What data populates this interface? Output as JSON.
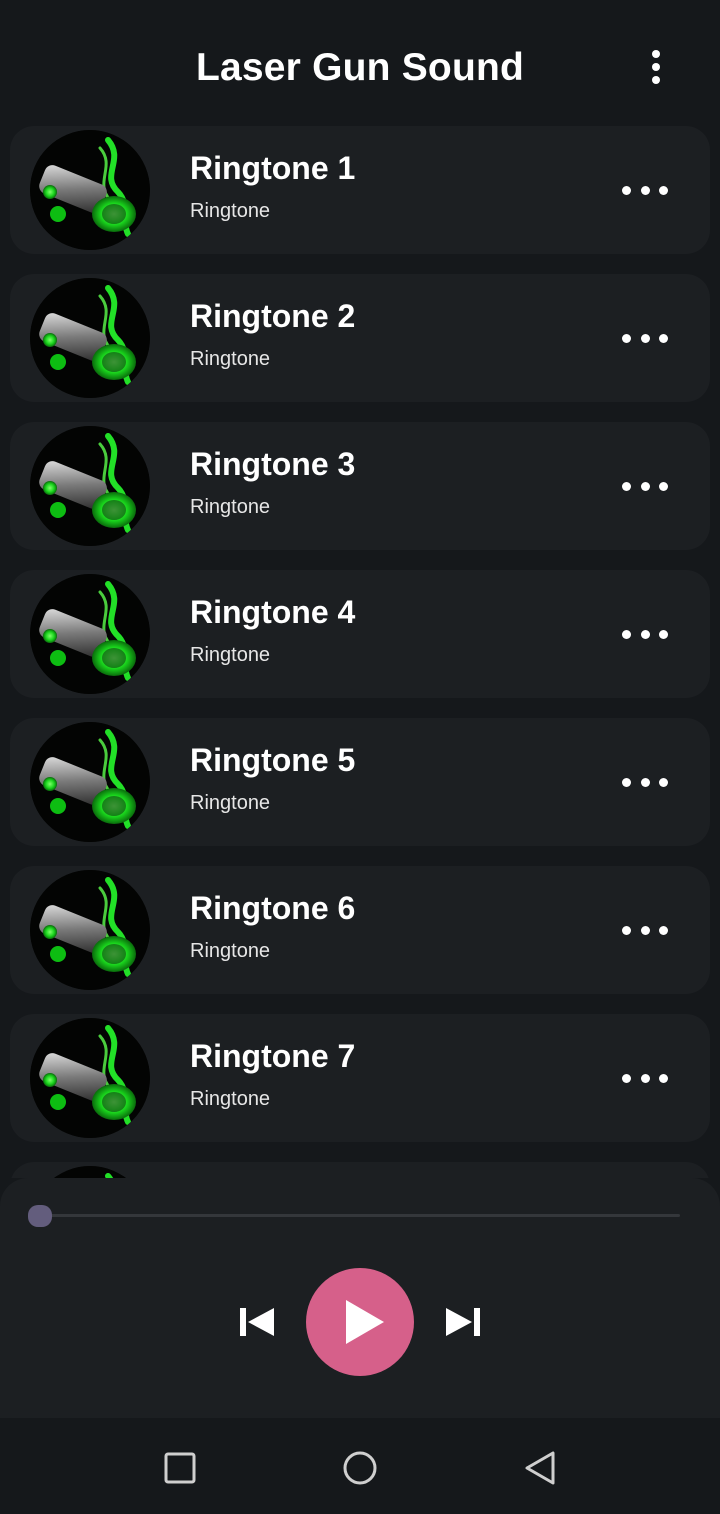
{
  "header": {
    "title": "Laser Gun Sound",
    "menu_icon": "more-vertical-icon"
  },
  "list": {
    "items": [
      {
        "title": "Ringtone 1",
        "subtitle": "Ringtone"
      },
      {
        "title": "Ringtone 2",
        "subtitle": "Ringtone"
      },
      {
        "title": "Ringtone 3",
        "subtitle": "Ringtone"
      },
      {
        "title": "Ringtone 4",
        "subtitle": "Ringtone"
      },
      {
        "title": "Ringtone 5",
        "subtitle": "Ringtone"
      },
      {
        "title": "Ringtone 6",
        "subtitle": "Ringtone"
      },
      {
        "title": "Ringtone 7",
        "subtitle": "Ringtone"
      }
    ],
    "item_more_icon": "more-horizontal-icon",
    "thumbnail_icon": "laser-gun-thumbnail"
  },
  "player": {
    "progress": 0,
    "prev_icon": "skip-previous-icon",
    "play_icon": "play-icon",
    "next_icon": "skip-next-icon",
    "play_color": "#d6608a",
    "seek_color": "#635d7d"
  },
  "nav": {
    "recents_icon": "square-icon",
    "home_icon": "circle-icon",
    "back_icon": "triangle-back-icon"
  }
}
